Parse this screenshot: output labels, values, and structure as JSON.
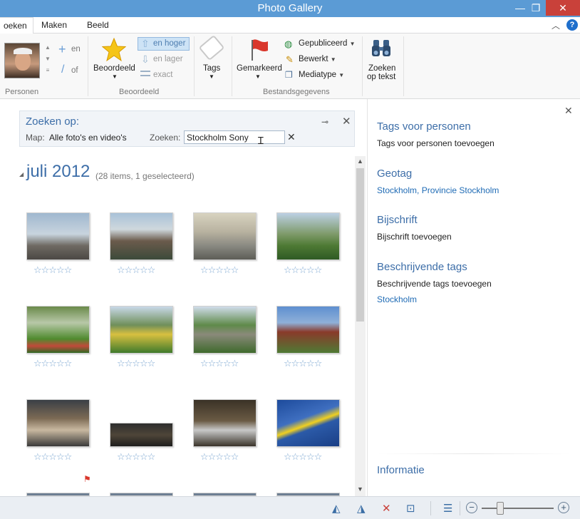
{
  "window": {
    "title": "Photo Gallery"
  },
  "tabs": [
    {
      "label": "oeken",
      "active": true
    },
    {
      "label": "Maken",
      "active": false
    },
    {
      "label": "Beeld",
      "active": false
    }
  ],
  "ribbon": {
    "personen": {
      "group_label": "Personen",
      "en_label": "en",
      "of_label": "of"
    },
    "beoordeeld": {
      "group_label": "Beoordeeld",
      "button_label": "Beoordeeld",
      "hoger_label": "en hoger",
      "lager_label": "en lager",
      "exact_label": "exact"
    },
    "tags": {
      "label": "Tags"
    },
    "bestandsgegevens": {
      "group_label": "Bestandsgegevens",
      "gemarkeerd_label": "Gemarkeerd",
      "gepubliceerd_label": "Gepubliceerd",
      "bewerkt_label": "Bewerkt",
      "mediatype_label": "Mediatype"
    },
    "zoeken_tekst": {
      "line1": "Zoeken",
      "line2": "op tekst"
    }
  },
  "search": {
    "heading": "Zoeken op:",
    "map_label": "Map:",
    "map_value": "Alle foto's en video's",
    "zoeken_label": "Zoeken:",
    "query": "Stockholm Sony"
  },
  "gallery": {
    "month": "juli 2012",
    "count": "(28 items, 1 geselecteerd)",
    "star_glyphs": "☆☆☆☆☆"
  },
  "details": {
    "tags_personen_title": "Tags voor personen",
    "tags_personen_action": "Tags voor personen toevoegen",
    "geotag_title": "Geotag",
    "geotag_value": "Stockholm, Provincie Stockholm",
    "bijschrift_title": "Bijschrift",
    "bijschrift_action": "Bijschrift toevoegen",
    "beschrijvende_title": "Beschrijvende tags",
    "beschrijvende_action": "Beschrijvende tags toevoegen",
    "beschrijvende_value": "Stockholm",
    "informatie_title": "Informatie"
  },
  "colors": {
    "accent": "#3d6ea8",
    "titlebar": "#5b9bd5",
    "close": "#c9413a",
    "link": "#1f6bb5"
  }
}
